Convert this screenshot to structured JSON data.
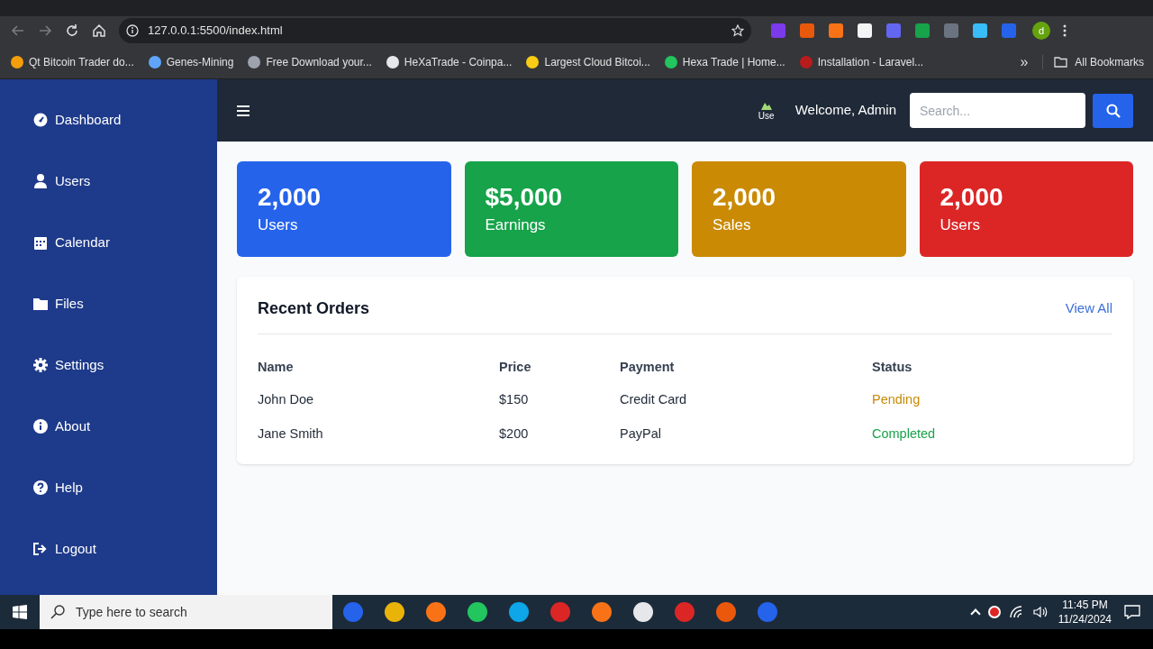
{
  "browser": {
    "url": "127.0.0.1:5500/index.html",
    "profile": "d",
    "bookmarks": [
      {
        "label": "Qt Bitcoin Trader do..."
      },
      {
        "label": "Genes-Mining"
      },
      {
        "label": "Free Download your..."
      },
      {
        "label": "HeXaTrade - Coinpa..."
      },
      {
        "label": "Largest Cloud Bitcoi..."
      },
      {
        "label": "Hexa Trade | Home..."
      },
      {
        "label": "Installation - Laravel..."
      }
    ],
    "more": "»",
    "all_bookmarks": "All Bookmarks"
  },
  "sidebar": {
    "items": [
      {
        "label": "Dashboard"
      },
      {
        "label": "Users"
      },
      {
        "label": "Calendar"
      },
      {
        "label": "Files"
      },
      {
        "label": "Settings"
      },
      {
        "label": "About"
      },
      {
        "label": "Help"
      },
      {
        "label": "Logout"
      }
    ]
  },
  "header": {
    "avatar_alt": "Use",
    "welcome": "Welcome, Admin",
    "search": {
      "placeholder": "Search..."
    }
  },
  "stats": [
    {
      "value": "2,000",
      "label": "Users",
      "color": "#2563eb"
    },
    {
      "value": "$5,000",
      "label": "Earnings",
      "color": "#16a34a"
    },
    {
      "value": "2,000",
      "label": "Sales",
      "color": "#ca8a04"
    },
    {
      "value": "2,000",
      "label": "Users",
      "color": "#dc2626"
    }
  ],
  "orders": {
    "title": "Recent Orders",
    "view_all": "View All",
    "columns": [
      "Name",
      "Price",
      "Payment",
      "Status"
    ],
    "rows": [
      {
        "cells": [
          "John Doe",
          "$150",
          "Credit Card",
          "Pending"
        ],
        "kind": "pending"
      },
      {
        "cells": [
          "Jane Smith",
          "$200",
          "PayPal",
          "Completed"
        ],
        "kind": "completed"
      }
    ]
  },
  "taskbar": {
    "search_placeholder": "Type here to search",
    "time": "11:45 PM",
    "date": "11/24/2024"
  }
}
